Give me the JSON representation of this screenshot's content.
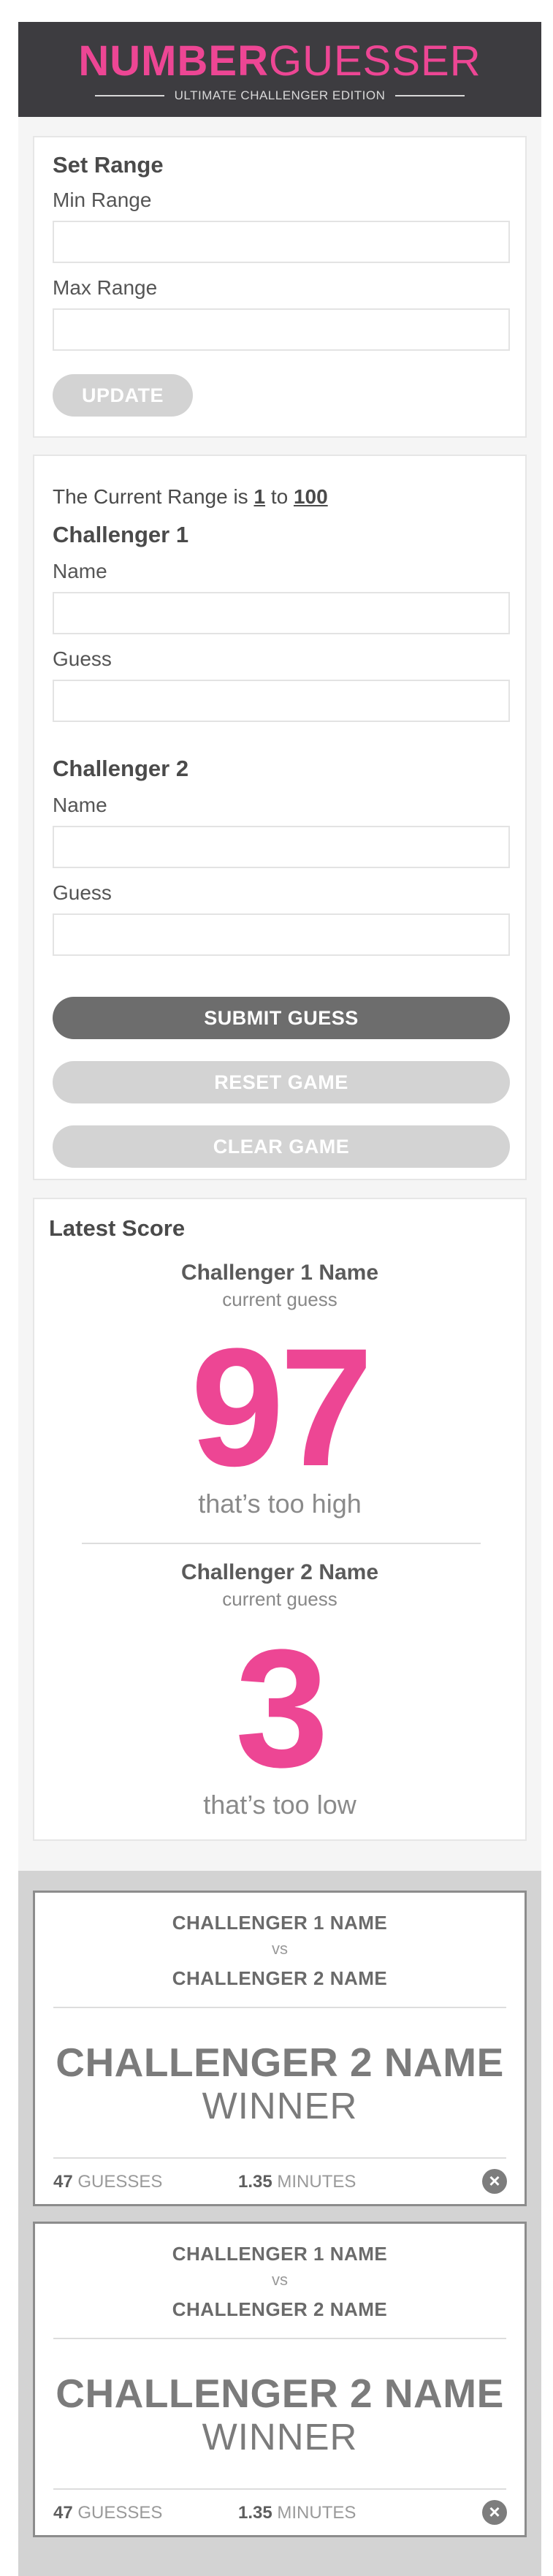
{
  "header": {
    "logo_bold": "NUMBER",
    "logo_light": "GUESSER",
    "subtitle": "ULTIMATE CHALLENGER EDITION"
  },
  "set_range": {
    "title": "Set Range",
    "min_label": "Min Range",
    "min_value": "",
    "max_label": "Max Range",
    "max_value": "",
    "update_label": "UPDATE"
  },
  "game": {
    "range_prefix": "The Current Range is",
    "range_min": "1",
    "range_to": "to",
    "range_max": "100",
    "challenger1": {
      "title": "Challenger 1",
      "name_label": "Name",
      "name_value": "",
      "guess_label": "Guess",
      "guess_value": ""
    },
    "challenger2": {
      "title": "Challenger 2",
      "name_label": "Name",
      "name_value": "",
      "guess_label": "Guess",
      "guess_value": ""
    },
    "submit_label": "SUBMIT GUESS",
    "reset_label": "RESET GAME",
    "clear_label": "CLEAR GAME"
  },
  "latest_score": {
    "title": "Latest Score",
    "entries": [
      {
        "name": "Challenger 1 Name",
        "sub": "current guess",
        "guess": "97",
        "message": "that’s too high"
      },
      {
        "name": "Challenger 2 Name",
        "sub": "current guess",
        "guess": "3",
        "message": "that’s too low"
      }
    ]
  },
  "results": [
    {
      "challenger1": "CHALLENGER 1 NAME",
      "vs": "vs",
      "challenger2": "CHALLENGER 2 NAME",
      "winner": "CHALLENGER 2 NAME",
      "winner_label": "WINNER",
      "guesses": "47",
      "guesses_label": "GUESSES",
      "minutes": "1.35",
      "minutes_label": "MINUTES",
      "close_icon": "close-icon"
    },
    {
      "challenger1": "CHALLENGER 1 NAME",
      "vs": "vs",
      "challenger2": "CHALLENGER 2 NAME",
      "winner": "CHALLENGER 2 NAME",
      "winner_label": "WINNER",
      "guesses": "47",
      "guesses_label": "GUESSES",
      "minutes": "1.35",
      "minutes_label": "MINUTES",
      "close_icon": "close-icon"
    }
  ],
  "colors": {
    "accent": "#ed4694",
    "header_bg": "#3d3c40",
    "button_dark": "#6d6d6d",
    "button_light": "#d3d3d3"
  }
}
